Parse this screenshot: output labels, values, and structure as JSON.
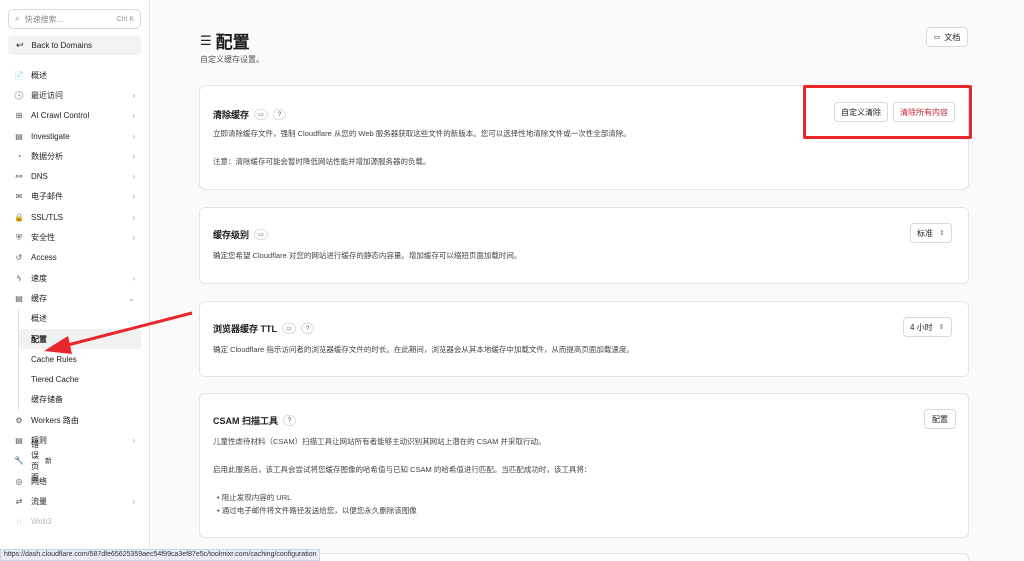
{
  "sidebar": {
    "search_placeholder": "快速搜索...",
    "search_shortcut": "Ctrl K",
    "back_label": "Back to Domains",
    "items": [
      {
        "label": "概述",
        "icon": "📄",
        "chev": ""
      },
      {
        "label": "最近访问",
        "icon": "🕓",
        "chev": "›"
      },
      {
        "label": "AI Crawl Control",
        "icon": "⊞",
        "chev": "›"
      },
      {
        "label": "Investigate",
        "icon": "▤",
        "chev": "›"
      },
      {
        "label": "数据分析",
        "icon": "◔",
        "chev": "›"
      },
      {
        "label": "DNS",
        "icon": "⚯",
        "chev": "›"
      },
      {
        "label": "电子邮件",
        "icon": "✉",
        "chev": "›"
      },
      {
        "label": "SSL/TLS",
        "icon": "🔒",
        "chev": "›"
      },
      {
        "label": "安全性",
        "icon": "⛨",
        "chev": "›"
      },
      {
        "label": "Access",
        "icon": "↺",
        "chev": ""
      },
      {
        "label": "速度",
        "icon": "ϟ",
        "chev": "›"
      },
      {
        "label": "缓存",
        "icon": "▤",
        "chev": "⌄"
      }
    ],
    "cache_subitems": [
      "概述",
      "配置",
      "Cache Rules",
      "Tiered Cache",
      "缓存储备"
    ],
    "items_after": [
      {
        "label": "Workers 路由",
        "icon": "⚙",
        "chev": ""
      },
      {
        "label": "规则",
        "icon": "▤",
        "chev": "›"
      },
      {
        "label": "错误页面",
        "icon": "🔧",
        "chev": "",
        "badge": "新"
      },
      {
        "label": "网络",
        "icon": "◎",
        "chev": ""
      },
      {
        "label": "流量",
        "icon": "⇄",
        "chev": "›"
      },
      {
        "label": "Web3",
        "icon": "◌",
        "chev": ""
      }
    ]
  },
  "header": {
    "title": "配置",
    "subtitle": "自定义缓存设置。",
    "doc_button": "文档"
  },
  "purge": {
    "title": "清除缓存",
    "desc": "立即清除缓存文件，强制 Cloudflare 从您的 Web 服务器获取这些文件的新版本。您可以选择性地清除文件或一次性全部清除。",
    "note": "注意：清除缓存可能会暂时降低网站性能并增加源服务器的负载。",
    "custom_button": "自定义清除",
    "all_button": "清除所有内容"
  },
  "cache_level": {
    "title": "缓存级别",
    "desc": "确定您希望 Cloudflare 对您的网站进行缓存的静态内容量。增加缓存可以缩短页面加载时间。",
    "value": "标准"
  },
  "browser_ttl": {
    "title": "浏览器缓存 TTL",
    "desc": "确定 Cloudflare 指示访问者的浏览器缓存文件的时长。在此期间，浏览器会从其本地缓存中加载文件，从而提高页面加载速度。",
    "value": "4 小时"
  },
  "csam": {
    "title": "CSAM 扫描工具",
    "desc": "儿童性虐待材料（CSAM）扫描工具让网站所有者能够主动识别其网站上潜在的 CSAM 并采取行动。",
    "desc2": "启用此服务后，该工具会尝试将您缓存图像的哈希值与已知 CSAM 的哈希值进行匹配。当匹配成功时，该工具将：",
    "bullets": [
      "阻止发现内容的 URL",
      "通过电子邮件将文件路径发送给您，以便您永久删除该图像"
    ],
    "button": "配置"
  },
  "status_url": "https://dash.cloudflare.com/587dfe65625359aec54f99ca3ef87e5c/toolmixr.com/caching/configuration",
  "colors": {
    "accent_red": "#e8262c",
    "danger_text": "#c0272d"
  }
}
